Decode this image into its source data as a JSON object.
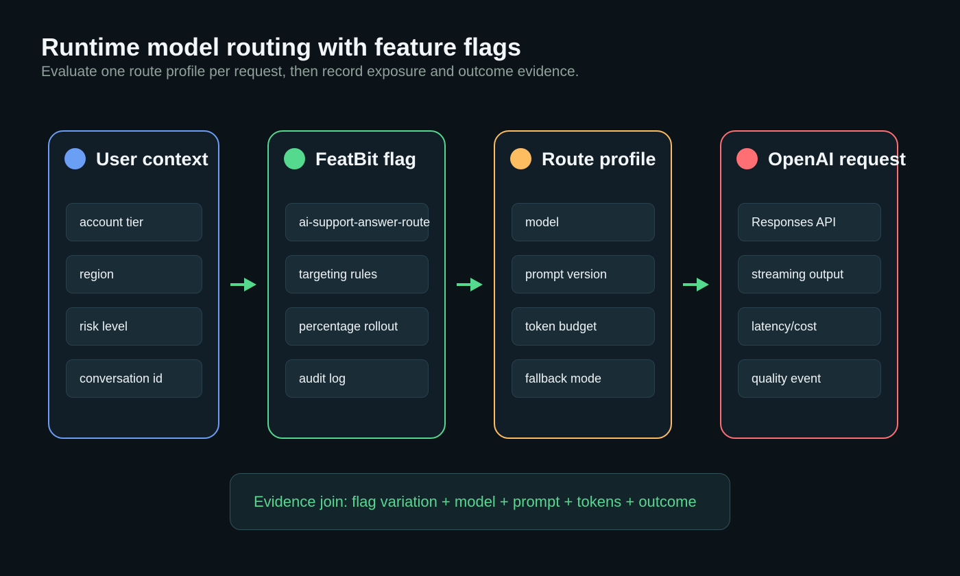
{
  "header": {
    "title": "Runtime model routing with feature flags",
    "subtitle": "Evaluate one route profile per request, then record exposure and outcome evidence."
  },
  "stages": [
    {
      "title": "User context",
      "color": "#6b9ef5",
      "items": [
        "account tier",
        "region",
        "risk level",
        "conversation id"
      ]
    },
    {
      "title": "FeatBit flag",
      "color": "#55d98f",
      "items": [
        "ai-support-answer-route",
        "targeting rules",
        "percentage rollout",
        "audit log"
      ]
    },
    {
      "title": "Route profile",
      "color": "#ffbd62",
      "items": [
        "model",
        "prompt version",
        "token budget",
        "fallback mode"
      ]
    },
    {
      "title": "OpenAI request",
      "color": "#ff6f73",
      "items": [
        "Responses API",
        "streaming output",
        "latency/cost",
        "quality event"
      ]
    }
  ],
  "arrow_color": "#55d98f",
  "evidence": {
    "text": "Evidence join: flag variation + model + prompt + tokens + outcome"
  }
}
